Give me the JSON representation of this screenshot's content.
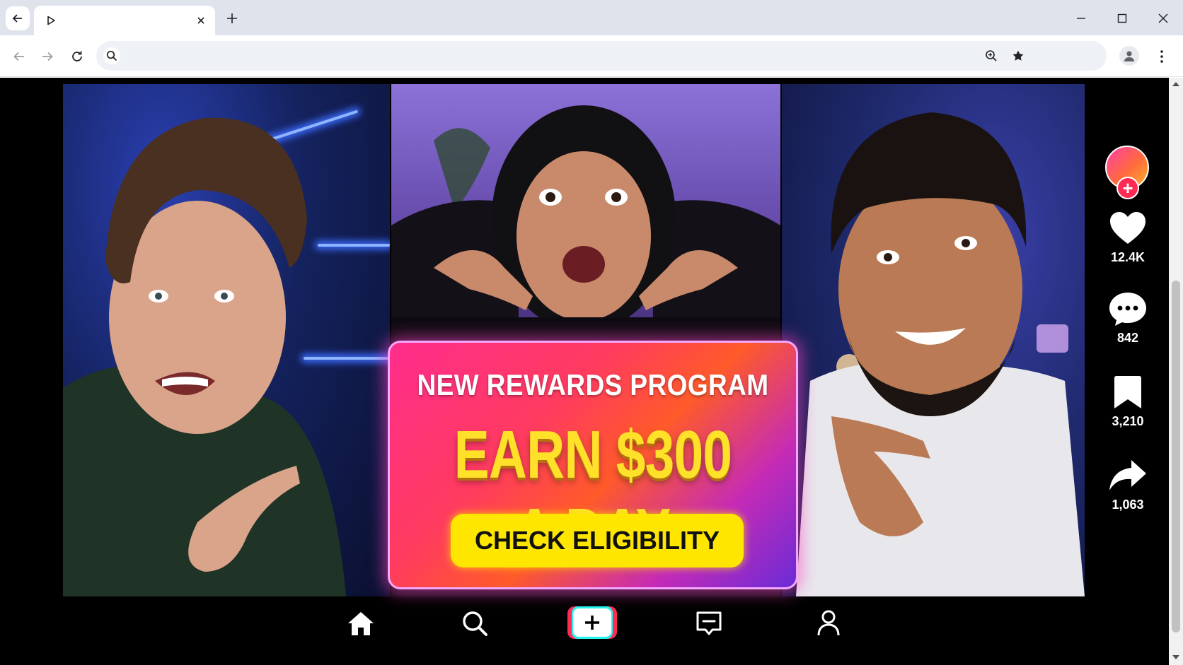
{
  "browser": {
    "tab_title": "",
    "address_value": "",
    "address_placeholder": ""
  },
  "promo": {
    "subtitle": "NEW REWARDS PROGRAM",
    "headline": "EARN $300 A DAY",
    "cta_label": "CHECK ELIGIBILITY"
  },
  "actions": {
    "likes": "12.4K",
    "comments": "842",
    "saves": "3,210",
    "shares": "1,063"
  },
  "colors": {
    "brand_red": "#fe2c55",
    "brand_cyan": "#25f4ee",
    "cta_yellow": "#ffe600",
    "headline_yellow": "#ffe12a"
  },
  "icons": {
    "bottom_nav": [
      "home-icon",
      "search-icon",
      "create-icon",
      "inbox-icon",
      "profile-icon"
    ],
    "rail": [
      "heart-icon",
      "comment-icon",
      "bookmark-icon",
      "share-icon"
    ]
  }
}
